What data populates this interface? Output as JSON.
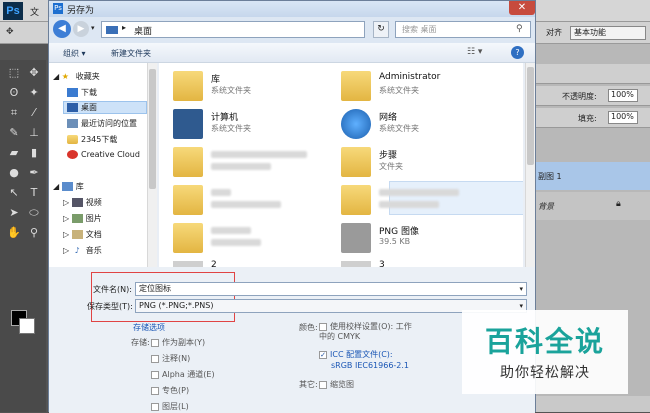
{
  "ps": {
    "logo": "Ps",
    "menu_first": "文",
    "workspace": "基本功能",
    "option_label": "对齐"
  },
  "dialog": {
    "title": "另存为",
    "address": "桌面",
    "search_placeholder": "搜索 桌面",
    "commands": {
      "organize": "组织 ▾",
      "new_folder": "新建文件夹"
    },
    "help": "?"
  },
  "nav": {
    "favorites_header": "收藏夹",
    "favorites": [
      "下载",
      "桌面",
      "最近访问的位置",
      "2345下载",
      "Creative Cloud"
    ],
    "library_header": "库",
    "libraries": [
      "视频",
      "图片",
      "文档",
      "音乐"
    ]
  },
  "files": [
    {
      "name": "库",
      "type": "系统文件夹"
    },
    {
      "name": "Administrator",
      "type": "系统文件夹"
    },
    {
      "name": "计算机",
      "type": "系统文件夹"
    },
    {
      "name": "网络",
      "type": "系统文件夹"
    },
    {
      "name": "步骤",
      "type": "文件夹"
    },
    {
      "name": "PNG 图像",
      "type": "39.5 KB"
    },
    {
      "name": "2",
      "type": ""
    },
    {
      "name": "3",
      "type": ""
    }
  ],
  "form": {
    "filename_label": "文件名(N):",
    "filename_value": "定位图标",
    "filetype_label": "保存类型(T):",
    "filetype_value": "PNG (*.PNG;*.PNS)",
    "save_options": "存储选项",
    "save_label": "存储:",
    "as_copy": "作为副本(Y)",
    "notes": "注释(N)",
    "alpha": "Alpha 通道(E)",
    "spot": "专色(P)",
    "layers": "图层(L)",
    "color_label": "颜色:",
    "proof": "使用校样设置(O): 工作中的 CMYK",
    "icc": "ICC 配置文件(C):",
    "icc_value": "sRGB IEC61966-2.1",
    "other_label": "其它:",
    "thumbnail": "缩览图"
  },
  "right_panel": {
    "opacity_label": "不透明度:",
    "opacity_value": "100%",
    "fill_label": "填充:",
    "fill_value": "100%",
    "layer_name": "副图 1",
    "background": "背景"
  },
  "watermark": {
    "title": "百科全说",
    "subtitle": "助你轻松解决"
  }
}
